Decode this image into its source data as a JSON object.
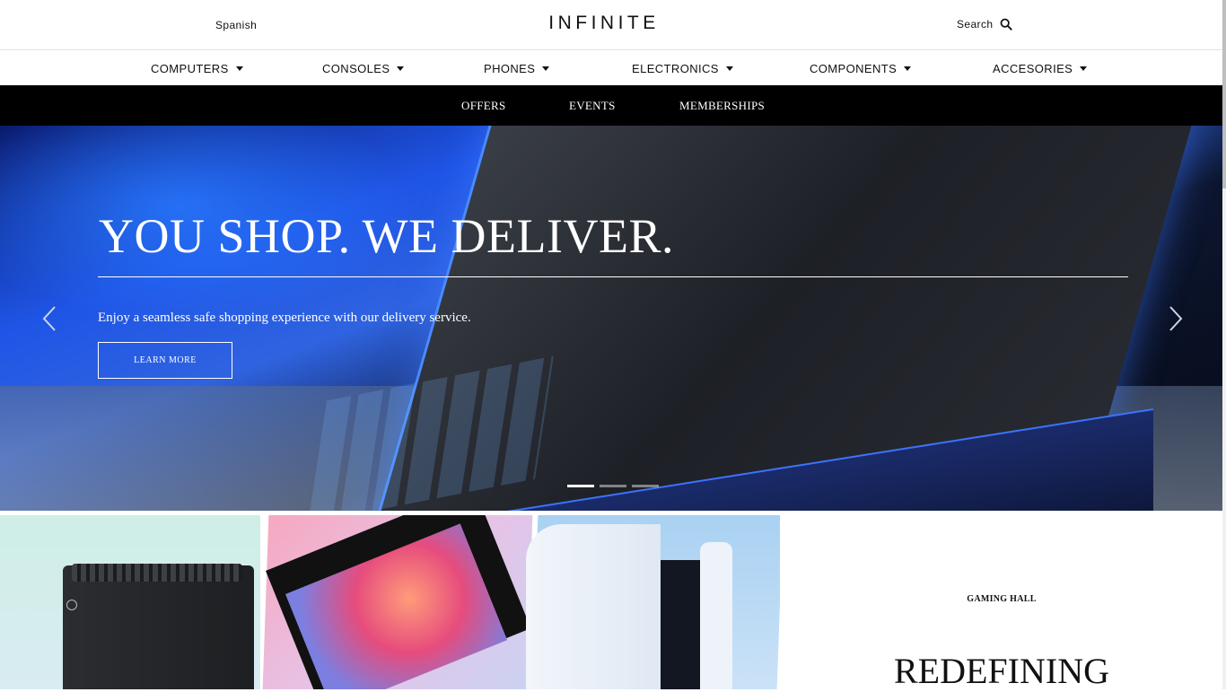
{
  "header": {
    "language": "Spanish",
    "logo": "INFINITE",
    "search_label": "Search",
    "search_icon": "search-icon"
  },
  "categories": [
    {
      "label": "COMPUTERS"
    },
    {
      "label": "CONSOLES"
    },
    {
      "label": "PHONES"
    },
    {
      "label": "ELECTRONICS"
    },
    {
      "label": "COMPONENTS"
    },
    {
      "label": "ACCESORIES"
    }
  ],
  "subnav": [
    {
      "label": "OFFERS"
    },
    {
      "label": "EVENTS"
    },
    {
      "label": "MEMBERSHIPS"
    }
  ],
  "hero": {
    "title": "YOU SHOP. WE DELIVER.",
    "subtitle": "Enjoy a seamless safe shopping experience with our delivery service.",
    "button_label": "LEARN MORE",
    "slide_count": 3,
    "active_slide": 1
  },
  "gaming": {
    "eyebrow": "GAMING HALL",
    "title": "REDEFINING"
  },
  "colors": {
    "nav_bg": "#000000",
    "accent_text": "#111111"
  }
}
